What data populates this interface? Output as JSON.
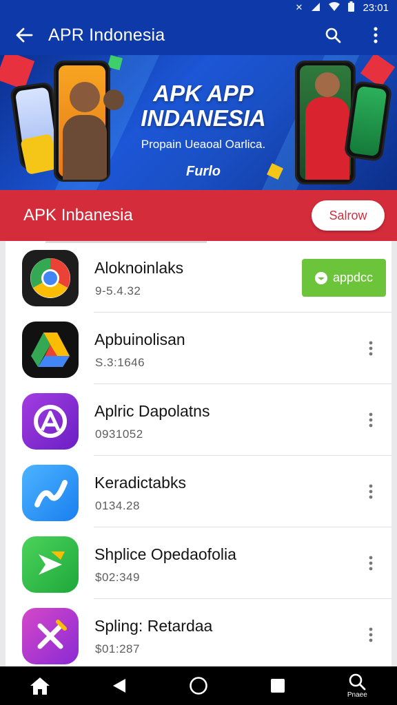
{
  "status_bar": {
    "time": "23:01",
    "icons": [
      "nfc-icon",
      "signal-icon",
      "wifi-icon",
      "battery-icon"
    ]
  },
  "appbar": {
    "title": "APR Indonesia",
    "back_icon": "arrow-left-icon",
    "search_icon": "search-icon",
    "more_icon": "more-vert-icon"
  },
  "banner": {
    "title_line1": "APK APP",
    "title_line2": "INDANESIA",
    "tagline": "Propain Ueaoal Oarlica.",
    "brand": "Furlo"
  },
  "section": {
    "title": "APK Inbanesia",
    "button_label": "Salrow"
  },
  "colors": {
    "primary": "#0d3aa8",
    "accent_red": "#d52c3c",
    "install_green": "#6cc43a"
  },
  "apps": [
    {
      "name": "Aloknoinlaks",
      "version": "9-5.4.32",
      "icon": "chrome-style-icon",
      "action": "install",
      "action_label": "appdcc"
    },
    {
      "name": "Apbuinolisan",
      "version": "S.3:1646",
      "icon": "drive-triangle-icon",
      "action": "more"
    },
    {
      "name": "Aplric Dapolatns",
      "version": "0931052",
      "icon": "purple-a-icon",
      "action": "more"
    },
    {
      "name": "Keradictabks",
      "version": "0134.28",
      "icon": "blue-swoosh-icon",
      "action": "more"
    },
    {
      "name": "Shplice Opedaofolia",
      "version": "$02:349",
      "icon": "green-arrow-icon",
      "action": "more"
    },
    {
      "name": "Spling: Retardaa",
      "version": "$01:287",
      "icon": "pink-x-icon",
      "action": "more"
    }
  ],
  "navbar": {
    "home_icon": "home-icon",
    "back_icon": "back-triangle-icon",
    "recents_home_icon": "circle-icon",
    "overview_icon": "square-icon",
    "search_icon": "search-icon",
    "search_label": "Pnaee"
  }
}
